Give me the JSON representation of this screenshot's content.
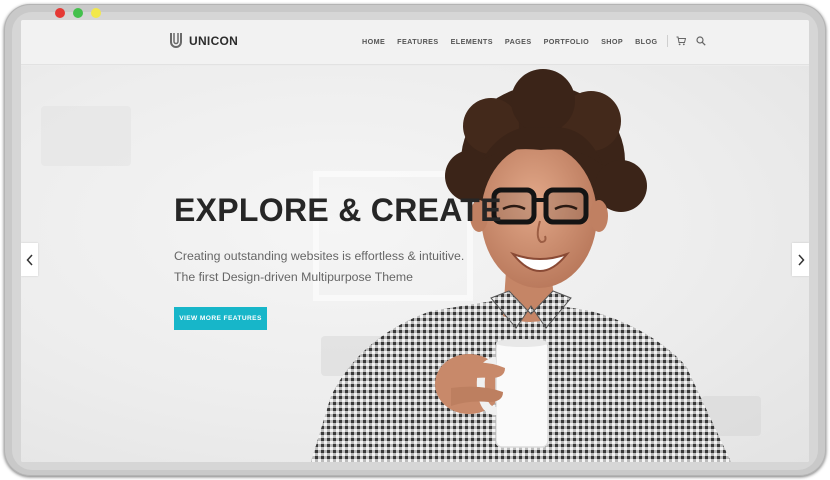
{
  "window": {
    "controls": [
      {
        "name": "close",
        "color": "#e53935"
      },
      {
        "name": "minimize",
        "color": "#43c04c"
      },
      {
        "name": "maximize",
        "color": "#f2e84b"
      }
    ]
  },
  "header": {
    "logo_text": "UNICON",
    "logo_icon": "u-logo-icon",
    "nav": [
      "HOME",
      "FEATURES",
      "ELEMENTS",
      "PAGES",
      "PORTFOLIO",
      "SHOP",
      "BLOG"
    ],
    "icons": [
      "cart-icon",
      "search-icon"
    ]
  },
  "hero": {
    "title": "EXPLORE & CREATE",
    "subtitle_line1": "Creating outstanding websites is effortless & intuitive.",
    "subtitle_line2": "The first Design-driven Multipurpose Theme",
    "cta_label": "VIEW MORE FEATURES",
    "arrows": [
      "chevron-left-icon",
      "chevron-right-icon"
    ]
  },
  "colors": {
    "accent": "#17b6c9",
    "title": "#262626",
    "nav": "#555555"
  }
}
